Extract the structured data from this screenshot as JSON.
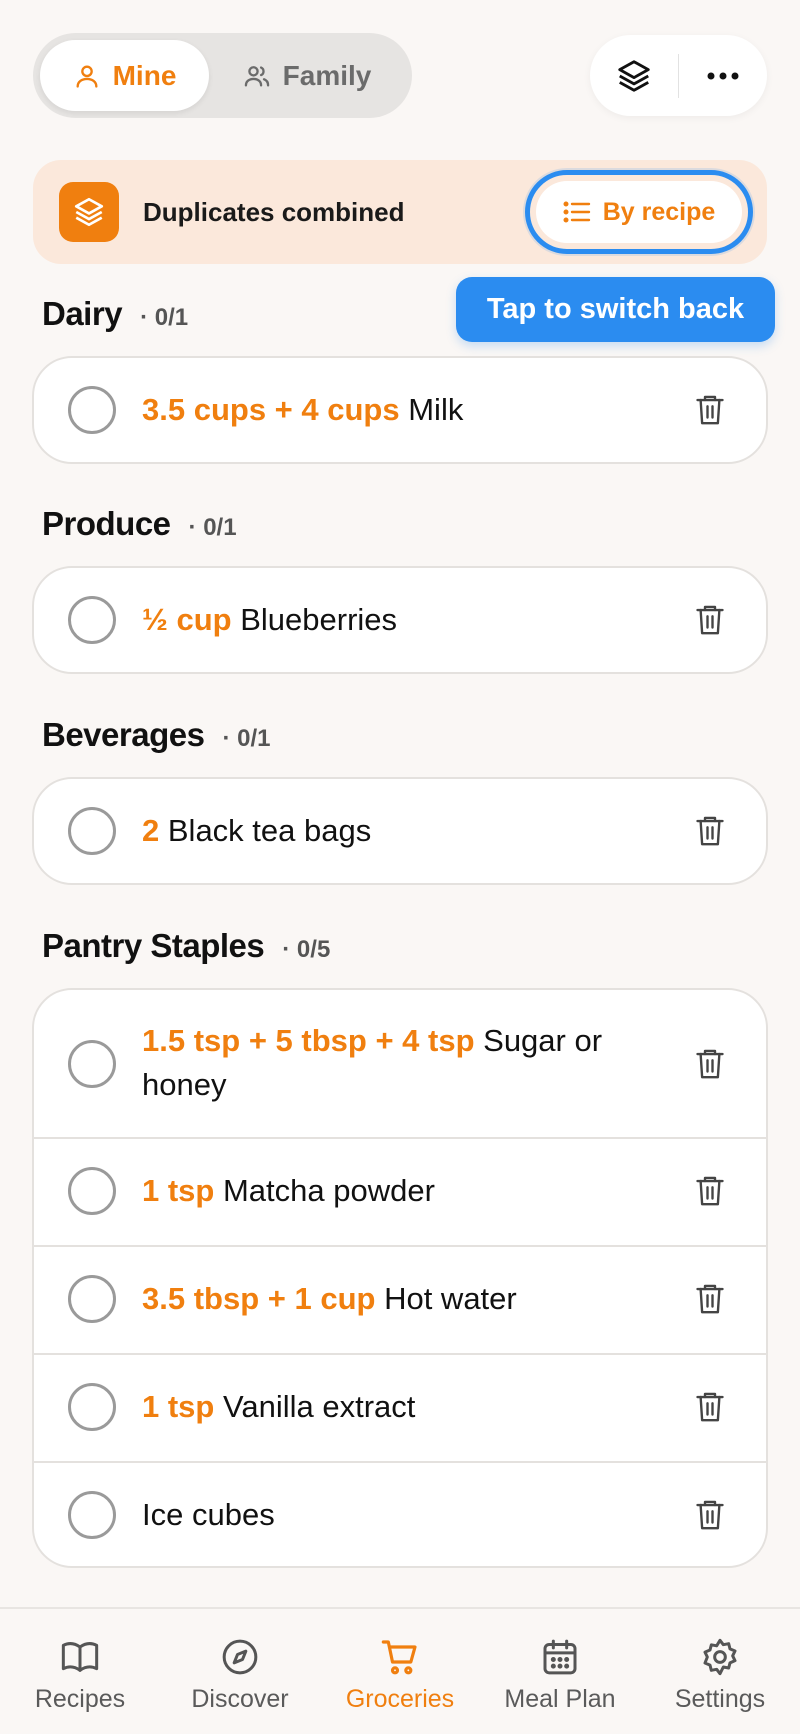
{
  "segment": {
    "mine_label": "Mine",
    "family_label": "Family",
    "selected": "Mine"
  },
  "header_actions": {
    "layers_icon": "layers-icon",
    "more_icon": "more-icon"
  },
  "banner": {
    "text": "Duplicates combined",
    "toggle_label": "By recipe"
  },
  "tooltip": "Tap to switch back",
  "sections": [
    {
      "title": "Dairy",
      "count": "· 0/1",
      "items": [
        {
          "qty": "3.5 cups + 4 cups",
          "name": "Milk",
          "checked": false
        }
      ]
    },
    {
      "title": "Produce",
      "count": "· 0/1",
      "items": [
        {
          "qty": "½ cup",
          "name": "Blueberries",
          "checked": false
        }
      ]
    },
    {
      "title": "Beverages",
      "count": "· 0/1",
      "items": [
        {
          "qty": "2",
          "name": "Black tea bags",
          "checked": false
        }
      ]
    },
    {
      "title": "Pantry Staples",
      "count": "· 0/5",
      "items": [
        {
          "qty": "1.5 tsp + 5 tbsp + 4 tsp",
          "name": "Sugar or honey",
          "checked": false
        },
        {
          "qty": "1 tsp",
          "name": "Matcha powder",
          "checked": false
        },
        {
          "qty": "3.5 tbsp + 1 cup",
          "name": "Hot water",
          "checked": false
        },
        {
          "qty": "1 tsp",
          "name": "Vanilla extract",
          "checked": false
        },
        {
          "qty": "",
          "name": "Ice cubes",
          "checked": false
        }
      ]
    }
  ],
  "tabs": [
    {
      "label": "Recipes",
      "icon": "book-icon",
      "active": false
    },
    {
      "label": "Discover",
      "icon": "compass-icon",
      "active": false
    },
    {
      "label": "Groceries",
      "icon": "cart-icon",
      "active": true
    },
    {
      "label": "Meal Plan",
      "icon": "calendar-icon",
      "active": false
    },
    {
      "label": "Settings",
      "icon": "gear-icon",
      "active": false
    }
  ],
  "colors": {
    "accent": "#f07f0f",
    "highlight": "#2b8cf0",
    "banner_bg": "#fbe8db"
  }
}
